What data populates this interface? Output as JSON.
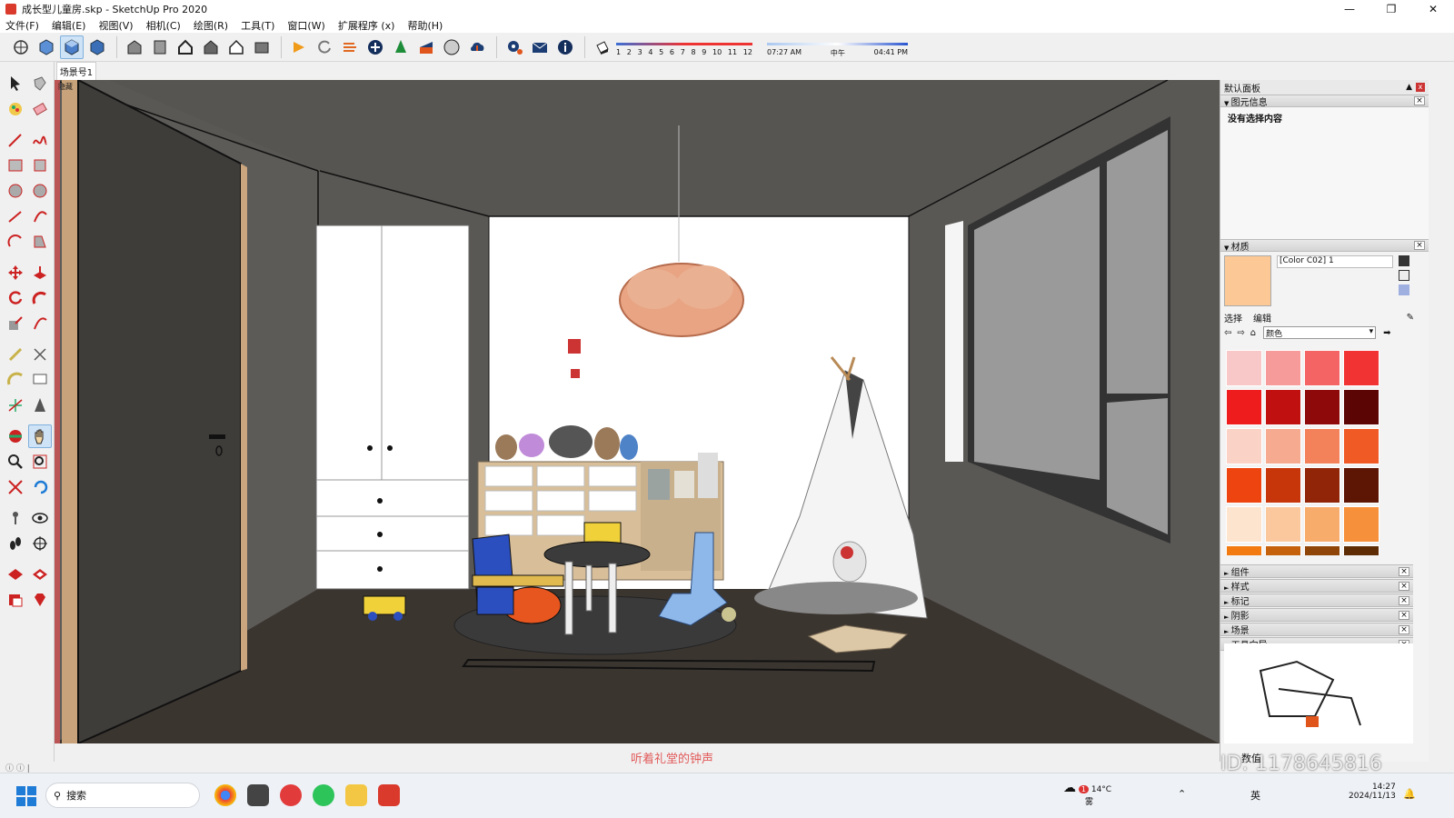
{
  "window": {
    "title": "成长型儿童房.skp - SketchUp Pro 2020"
  },
  "menu": [
    "文件(F)",
    "编辑(E)",
    "视图(V)",
    "相机(C)",
    "绘图(R)",
    "工具(T)",
    "窗口(W)",
    "扩展程序 (x)",
    "帮助(H)"
  ],
  "toolbar": {
    "month_ticks": [
      "1",
      "2",
      "3",
      "4",
      "5",
      "6",
      "7",
      "8",
      "9",
      "10",
      "11",
      "12"
    ],
    "time_start": "07:27 AM",
    "time_mid": "中午",
    "time_end": "04:41 PM"
  },
  "scenes": {
    "active_tab": "场景号1"
  },
  "viewport": {
    "label": "隐藏"
  },
  "tray": {
    "title": "默认面板",
    "entity_info": {
      "title": "图元信息",
      "body": "没有选择内容"
    },
    "materials": {
      "title": "材质",
      "name": "[Color C02] 1",
      "swatch": "#fcc996",
      "tab_select": "选择",
      "tab_edit": "编辑",
      "library": "颜色",
      "colors": [
        "#f8c7c7",
        "#f79a9a",
        "#f46464",
        "#f23333",
        "#ee1c1c",
        "#c01010",
        "#8e0a0a",
        "#5c0505",
        "#fad2c6",
        "#f6aa90",
        "#f3825a",
        "#f05a25",
        "#ee4510",
        "#c7350b",
        "#902508",
        "#5e1604",
        "#fde4cf",
        "#fbc89e",
        "#f8ac6c",
        "#f6903b",
        "#f27a10",
        "#c5610c",
        "#904508",
        "#5d2c05"
      ]
    },
    "collapsed_panels": [
      "组件",
      "样式",
      "标记",
      "阴影",
      "场景",
      "工具向导"
    ]
  },
  "status": {
    "caption": "听着礼堂的钟声",
    "measurement_label": "数值"
  },
  "taskbar": {
    "search": "搜索",
    "weather_temp": "14°C",
    "weather_desc": "雾",
    "weather_badge": "1",
    "time": "14:27",
    "date": "2024/11/13",
    "ime": "英"
  },
  "watermark": {
    "id": "ID: 1178645816"
  },
  "accent": {
    "active_tool": "#cfe3f7",
    "sketchup_red": "#d93a2b"
  }
}
